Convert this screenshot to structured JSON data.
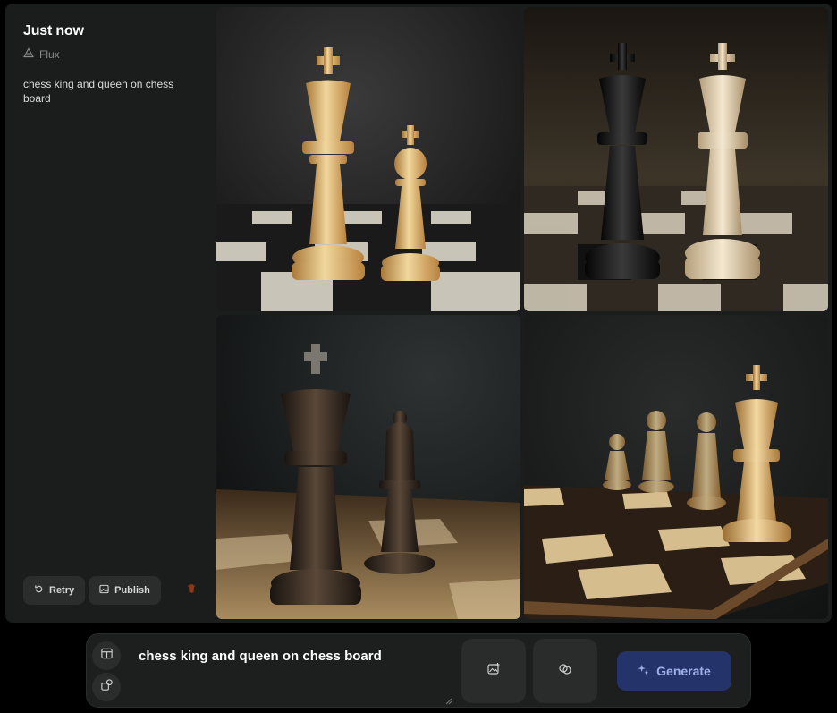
{
  "generation": {
    "time_label": "Just now",
    "model_name": "Flux",
    "prompt_text": "chess king and queen on chess board",
    "icons": {
      "model": "flux-triangle-icon"
    }
  },
  "actions": {
    "retry_label": "Retry",
    "publish_label": "Publish",
    "icons": {
      "retry": "retry-icon",
      "publish": "image-publish-icon",
      "delete": "trash-icon"
    }
  },
  "images": [
    {
      "name": "result-image-1",
      "alt": "chess king and queen on chess board"
    },
    {
      "name": "result-image-2",
      "alt": "chess king and queen on chess board"
    },
    {
      "name": "result-image-3",
      "alt": "chess king and queen on chess board"
    },
    {
      "name": "result-image-4",
      "alt": "chess king and queen on chess board"
    }
  ],
  "composer": {
    "prompt_value": "chess king and queen on chess board",
    "generate_label": "Generate",
    "icons": [
      "layout-icon",
      "shapes-icon",
      "image-add-icon",
      "link-circles-icon",
      "sparkles-icon"
    ]
  },
  "colors": {
    "background": "#000000",
    "panel": "#1b1c1c",
    "button": "#2b2c2c",
    "generate_bg": "#24346b",
    "generate_text": "#9fb0e8",
    "delete_icon": "#8a3a1c"
  }
}
